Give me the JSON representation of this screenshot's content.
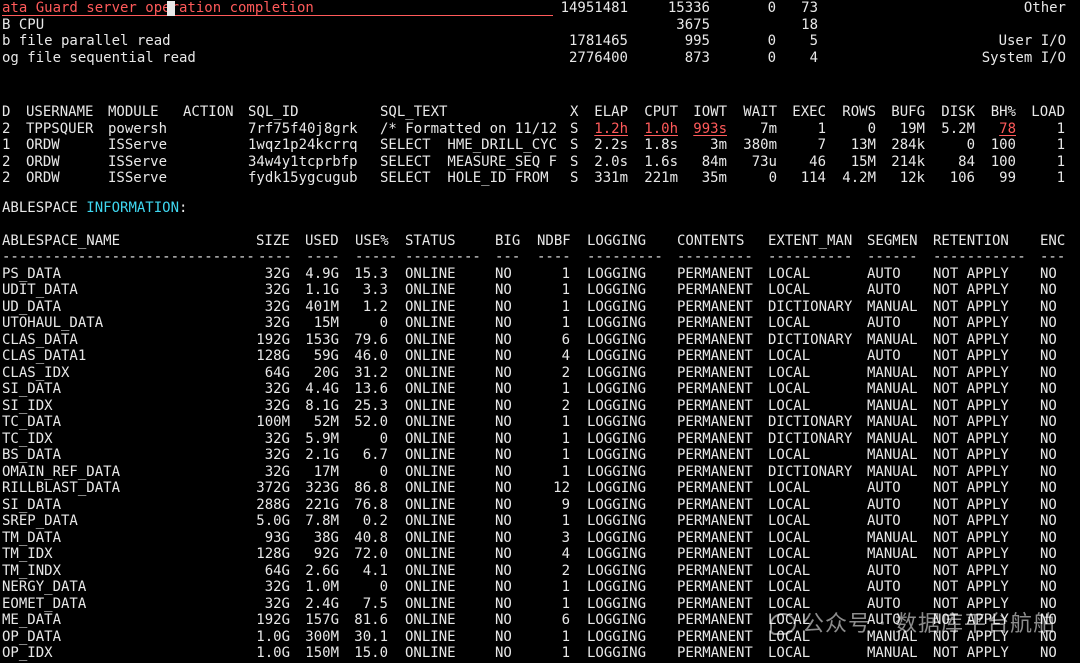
{
  "wait_events": [
    {
      "event": "ata Guard server operation completion",
      "waits": "14951481",
      "time": "15336",
      "c3": "0",
      "pct": "73",
      "wclass": "Other"
    },
    {
      "event": "B CPU",
      "waits": "",
      "time": "3675",
      "c3": "",
      "pct": "18",
      "wclass": ""
    },
    {
      "event": "b file parallel read",
      "waits": "1781465",
      "time": "995",
      "c3": "0",
      "pct": "5",
      "wclass": "User I/O"
    },
    {
      "event": "og file sequential read",
      "waits": "2776400",
      "time": "873",
      "c3": "0",
      "pct": "4",
      "wclass": "System I/O"
    }
  ],
  "sql_table": {
    "headers": [
      "D",
      "USERNAME",
      "MODULE",
      "ACTION",
      "SQL_ID",
      "SQL_TEXT",
      "X",
      "ELAP",
      "CPUT",
      "IOWT",
      "WAIT",
      "EXEC",
      "ROWS",
      "BUFG",
      "DISK",
      "BH%",
      "LOAD"
    ],
    "rows": [
      [
        "2",
        "TPPSQUER",
        "powersh",
        "",
        "7rf75f40j8grk",
        "/* Formatted on 11/12",
        "S",
        "1.2h",
        "1.0h",
        "993s",
        "7m",
        "1",
        "0",
        "19M",
        "5.2M",
        "78",
        "1"
      ],
      [
        "1",
        "ORDW",
        "ISServe",
        "",
        "1wqz1p24kcrrq",
        "SELECT  HME_DRILL_CYC",
        "S",
        "2.2s",
        "1.8s",
        "3m",
        "380m",
        "7",
        "13M",
        "284k",
        "0",
        "100",
        "1"
      ],
      [
        "2",
        "ORDW",
        "ISServe",
        "",
        "34w4y1tcprbfp",
        "SELECT  MEASURE_SEQ F",
        "S",
        "2.0s",
        "1.6s",
        "84m",
        "73u",
        "46",
        "15M",
        "214k",
        "84",
        "100",
        "1"
      ],
      [
        "2",
        "ORDW",
        "ISServe",
        "",
        "fydk15ygcugub",
        "SELECT  HOLE_ID FROM",
        "S",
        "331m",
        "221m",
        "35m",
        "0",
        "114",
        "4.2M",
        "12k",
        "106",
        "99",
        "1"
      ]
    ]
  },
  "tablespace_title": {
    "prefix": "ABLESPACE ",
    "highlight": "INFORMATION",
    "suffix": ":"
  },
  "tablespace_table": {
    "headers": [
      "ABLESPACE_NAME",
      "SIZE",
      "USED",
      "USE%",
      "STATUS",
      "BIG",
      "NDBF",
      "LOGGING",
      "CONTENTS",
      "EXTENT_MAN",
      "SEGMEN",
      "RETENTION",
      "ENC"
    ],
    "separators": [
      "------------------------------",
      "----",
      "----",
      "-----",
      "---------",
      "---",
      "----",
      "---------",
      "---------",
      "----------",
      "------",
      "-----------",
      "---"
    ],
    "rows": [
      [
        "PS_DATA",
        "32G",
        "4.9G",
        "15.3",
        "ONLINE",
        "NO",
        "1",
        "LOGGING",
        "PERMANENT",
        "LOCAL",
        "AUTO",
        "NOT APPLY",
        "NO"
      ],
      [
        "UDIT_DATA",
        "32G",
        "1.1G",
        "3.3",
        "ONLINE",
        "NO",
        "1",
        "LOGGING",
        "PERMANENT",
        "LOCAL",
        "AUTO",
        "NOT APPLY",
        "NO"
      ],
      [
        "UD_DATA",
        "32G",
        "401M",
        "1.2",
        "ONLINE",
        "NO",
        "1",
        "LOGGING",
        "PERMANENT",
        "DICTIONARY",
        "MANUAL",
        "NOT APPLY",
        "NO"
      ],
      [
        "UTOHAUL_DATA",
        "32G",
        "15M",
        "0",
        "ONLINE",
        "NO",
        "1",
        "LOGGING",
        "PERMANENT",
        "LOCAL",
        "AUTO",
        "NOT APPLY",
        "NO"
      ],
      [
        "CLAS_DATA",
        "192G",
        "153G",
        "79.6",
        "ONLINE",
        "NO",
        "6",
        "LOGGING",
        "PERMANENT",
        "DICTIONARY",
        "MANUAL",
        "NOT APPLY",
        "NO"
      ],
      [
        "CLAS_DATA1",
        "128G",
        "59G",
        "46.0",
        "ONLINE",
        "NO",
        "4",
        "LOGGING",
        "PERMANENT",
        "LOCAL",
        "AUTO",
        "NOT APPLY",
        "NO"
      ],
      [
        "CLAS_IDX",
        "64G",
        "20G",
        "31.2",
        "ONLINE",
        "NO",
        "2",
        "LOGGING",
        "PERMANENT",
        "LOCAL",
        "MANUAL",
        "NOT APPLY",
        "NO"
      ],
      [
        "SI_DATA",
        "32G",
        "4.4G",
        "13.6",
        "ONLINE",
        "NO",
        "1",
        "LOGGING",
        "PERMANENT",
        "LOCAL",
        "MANUAL",
        "NOT APPLY",
        "NO"
      ],
      [
        "SI_IDX",
        "32G",
        "8.1G",
        "25.3",
        "ONLINE",
        "NO",
        "2",
        "LOGGING",
        "PERMANENT",
        "LOCAL",
        "MANUAL",
        "NOT APPLY",
        "NO"
      ],
      [
        "TC_DATA",
        "100M",
        "52M",
        "52.0",
        "ONLINE",
        "NO",
        "1",
        "LOGGING",
        "PERMANENT",
        "DICTIONARY",
        "MANUAL",
        "NOT APPLY",
        "NO"
      ],
      [
        "TC_IDX",
        "32G",
        "5.9M",
        "0",
        "ONLINE",
        "NO",
        "1",
        "LOGGING",
        "PERMANENT",
        "DICTIONARY",
        "MANUAL",
        "NOT APPLY",
        "NO"
      ],
      [
        "BS_DATA",
        "32G",
        "2.1G",
        "6.7",
        "ONLINE",
        "NO",
        "1",
        "LOGGING",
        "PERMANENT",
        "LOCAL",
        "MANUAL",
        "NOT APPLY",
        "NO"
      ],
      [
        "OMAIN_REF_DATA",
        "32G",
        "17M",
        "0",
        "ONLINE",
        "NO",
        "1",
        "LOGGING",
        "PERMANENT",
        "DICTIONARY",
        "MANUAL",
        "NOT APPLY",
        "NO"
      ],
      [
        "RILLBLAST_DATA",
        "372G",
        "323G",
        "86.8",
        "ONLINE",
        "NO",
        "12",
        "LOGGING",
        "PERMANENT",
        "LOCAL",
        "AUTO",
        "NOT APPLY",
        "NO"
      ],
      [
        "SI_DATA",
        "288G",
        "221G",
        "76.8",
        "ONLINE",
        "NO",
        "9",
        "LOGGING",
        "PERMANENT",
        "LOCAL",
        "AUTO",
        "NOT APPLY",
        "NO"
      ],
      [
        "SREP_DATA",
        "5.0G",
        "7.8M",
        "0.2",
        "ONLINE",
        "NO",
        "1",
        "LOGGING",
        "PERMANENT",
        "LOCAL",
        "AUTO",
        "NOT APPLY",
        "NO"
      ],
      [
        "TM_DATA",
        "93G",
        "38G",
        "40.8",
        "ONLINE",
        "NO",
        "3",
        "LOGGING",
        "PERMANENT",
        "LOCAL",
        "MANUAL",
        "NOT APPLY",
        "NO"
      ],
      [
        "TM_IDX",
        "128G",
        "92G",
        "72.0",
        "ONLINE",
        "NO",
        "4",
        "LOGGING",
        "PERMANENT",
        "LOCAL",
        "MANUAL",
        "NOT APPLY",
        "NO"
      ],
      [
        "TM_INDX",
        "64G",
        "2.6G",
        "4.1",
        "ONLINE",
        "NO",
        "2",
        "LOGGING",
        "PERMANENT",
        "LOCAL",
        "AUTO",
        "NOT APPLY",
        "NO"
      ],
      [
        "NERGY_DATA",
        "32G",
        "1.0M",
        "0",
        "ONLINE",
        "NO",
        "1",
        "LOGGING",
        "PERMANENT",
        "LOCAL",
        "AUTO",
        "NOT APPLY",
        "NO"
      ],
      [
        "EOMET_DATA",
        "32G",
        "2.4G",
        "7.5",
        "ONLINE",
        "NO",
        "1",
        "LOGGING",
        "PERMANENT",
        "LOCAL",
        "AUTO",
        "NOT APPLY",
        "NO"
      ],
      [
        "ME_DATA",
        "192G",
        "157G",
        "81.6",
        "ONLINE",
        "NO",
        "6",
        "LOGGING",
        "PERMANENT",
        "LOCAL",
        "AUTO",
        "NOT APPLY",
        "NO"
      ],
      [
        "OP_DATA",
        "1.0G",
        "300M",
        "30.1",
        "ONLINE",
        "NO",
        "1",
        "LOGGING",
        "PERMANENT",
        "LOCAL",
        "MANUAL",
        "NOT APPLY",
        "NO"
      ],
      [
        "OP_IDX",
        "1.0G",
        "150M",
        "15.0",
        "ONLINE",
        "NO",
        "1",
        "LOGGING",
        "PERMANENT",
        "LOCAL",
        "MANUAL",
        "NOT APPLY",
        "NO"
      ]
    ]
  },
  "watermark": {
    "text": "公众号 · 数据库平台航舶"
  },
  "colors": {
    "background": "#000000",
    "text": "#e8e8e8",
    "alert": "#ff5a5a",
    "highlight": "#3fd7f0"
  }
}
